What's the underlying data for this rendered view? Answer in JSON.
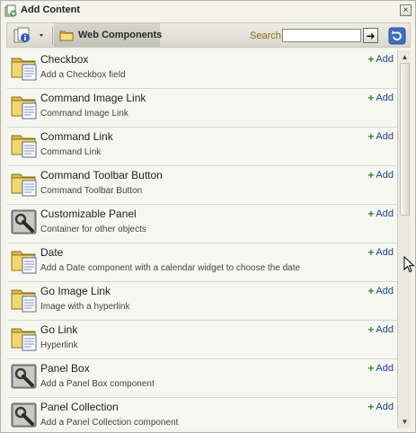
{
  "window": {
    "title": "Add Content",
    "close_glyph": "×"
  },
  "toolbar": {
    "breadcrumb_label": "Web Components",
    "search_label": "Search",
    "search_value": "",
    "go_glyph": "➜"
  },
  "icons": {
    "title": "add-content-icon",
    "info": "info-dropdown-icon",
    "folder": "folder-icon",
    "refresh": "refresh-icon",
    "component_folder": "folder-document-icon",
    "component_tool": "wrench-tool-icon"
  },
  "colors": {
    "add_link": "#1f3f8f",
    "search_label": "#8a6a20",
    "plus": "#2e8b2e"
  },
  "items": [
    {
      "title": "Checkbox",
      "description": "Add a Checkbox field",
      "icon": "folder-document-icon",
      "action": "Add"
    },
    {
      "title": "Command Image Link",
      "description": "Command Image Link",
      "icon": "folder-document-icon",
      "action": "Add"
    },
    {
      "title": "Command Link",
      "description": "Command Link",
      "icon": "folder-document-icon",
      "action": "Add"
    },
    {
      "title": "Command Toolbar Button",
      "description": "Command Toolbar Button",
      "icon": "folder-document-icon",
      "action": "Add"
    },
    {
      "title": "Customizable Panel",
      "description": "Container for other objects",
      "icon": "wrench-tool-icon",
      "action": "Add"
    },
    {
      "title": "Date",
      "description": "Add a Date component with a calendar widget to choose the date",
      "icon": "folder-document-icon",
      "action": "Add"
    },
    {
      "title": "Go Image Link",
      "description": "Image with a hyperlink",
      "icon": "folder-document-icon",
      "action": "Add"
    },
    {
      "title": "Go Link",
      "description": "Hyperlink",
      "icon": "folder-document-icon",
      "action": "Add"
    },
    {
      "title": "Panel Box",
      "description": "Add a Panel Box component",
      "icon": "wrench-tool-icon",
      "action": "Add"
    },
    {
      "title": "Panel Collection",
      "description": "Add a Panel Collection component",
      "icon": "wrench-tool-icon",
      "action": "Add"
    }
  ]
}
